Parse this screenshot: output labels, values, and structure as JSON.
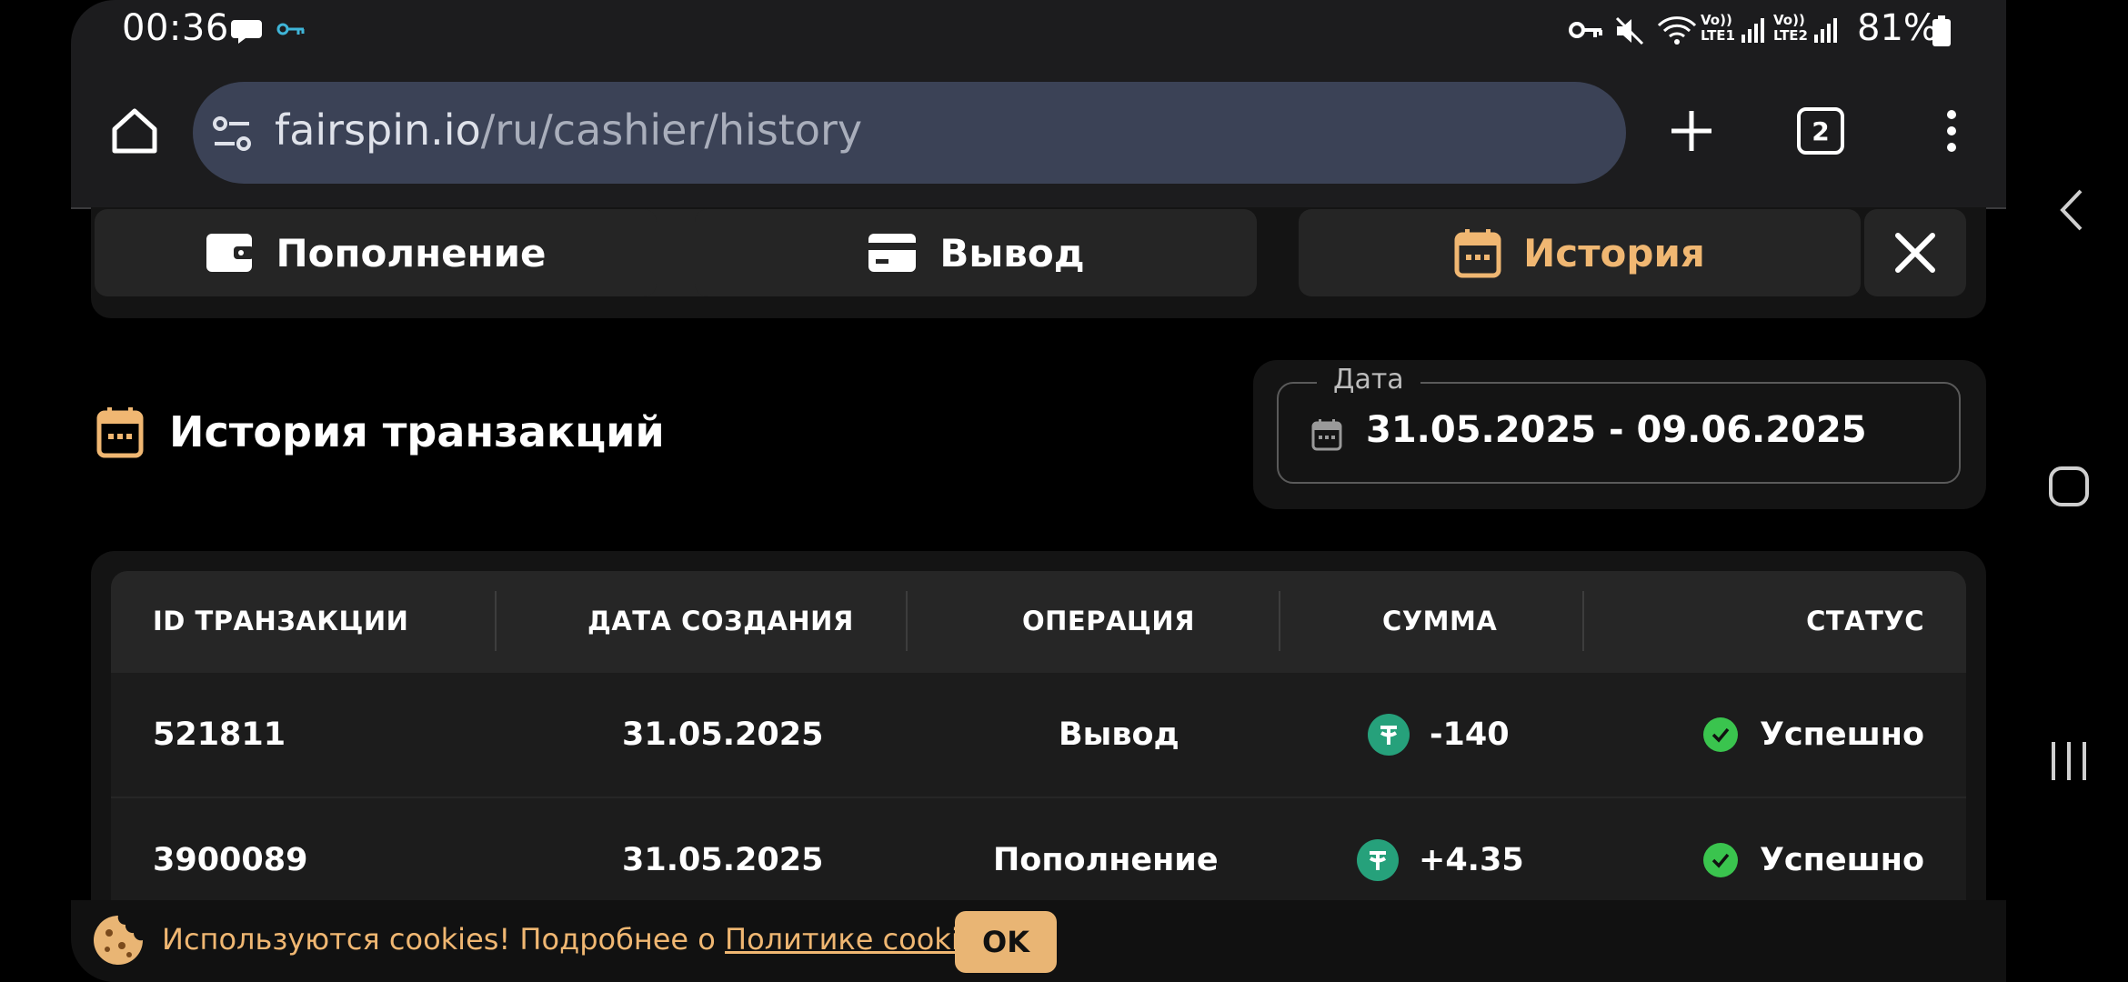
{
  "statusbar": {
    "time": "00:36",
    "battery": "81%",
    "lte1": "Vo)) LTE1",
    "lte2": "Vo)) LTE2"
  },
  "browser": {
    "url_host": "fairspin.io",
    "url_path": "/ru/cashier/history",
    "tab_count": "2"
  },
  "tabs": [
    {
      "label": "Пополнение",
      "active": false
    },
    {
      "label": "Вывод",
      "active": false
    },
    {
      "label": "История",
      "active": true
    }
  ],
  "history": {
    "title": "История транзакций",
    "date_label": "Дата",
    "date_range": "31.05.2025 - 09.06.2025"
  },
  "table": {
    "headers": [
      "ID ТРАНЗАКЦИИ",
      "ДАТА СОЗДАНИЯ",
      "ОПЕРАЦИЯ",
      "СУММА",
      "СТАТУС"
    ],
    "rows": [
      {
        "id": "521811",
        "date": "31.05.2025",
        "operation": "Вывод",
        "amount": "-140",
        "status": "Успешно"
      },
      {
        "id": "3900089",
        "date": "31.05.2025",
        "operation": "Пополнение",
        "amount": "+4.35",
        "status": "Успешно"
      }
    ]
  },
  "cookie": {
    "text": "Используются cookies! Подробнее о ",
    "link": "Политике cookies",
    "ok": "OK"
  },
  "colors": {
    "accent": "#f0b772",
    "usdt": "#26a17b",
    "success": "#3ac44e"
  }
}
